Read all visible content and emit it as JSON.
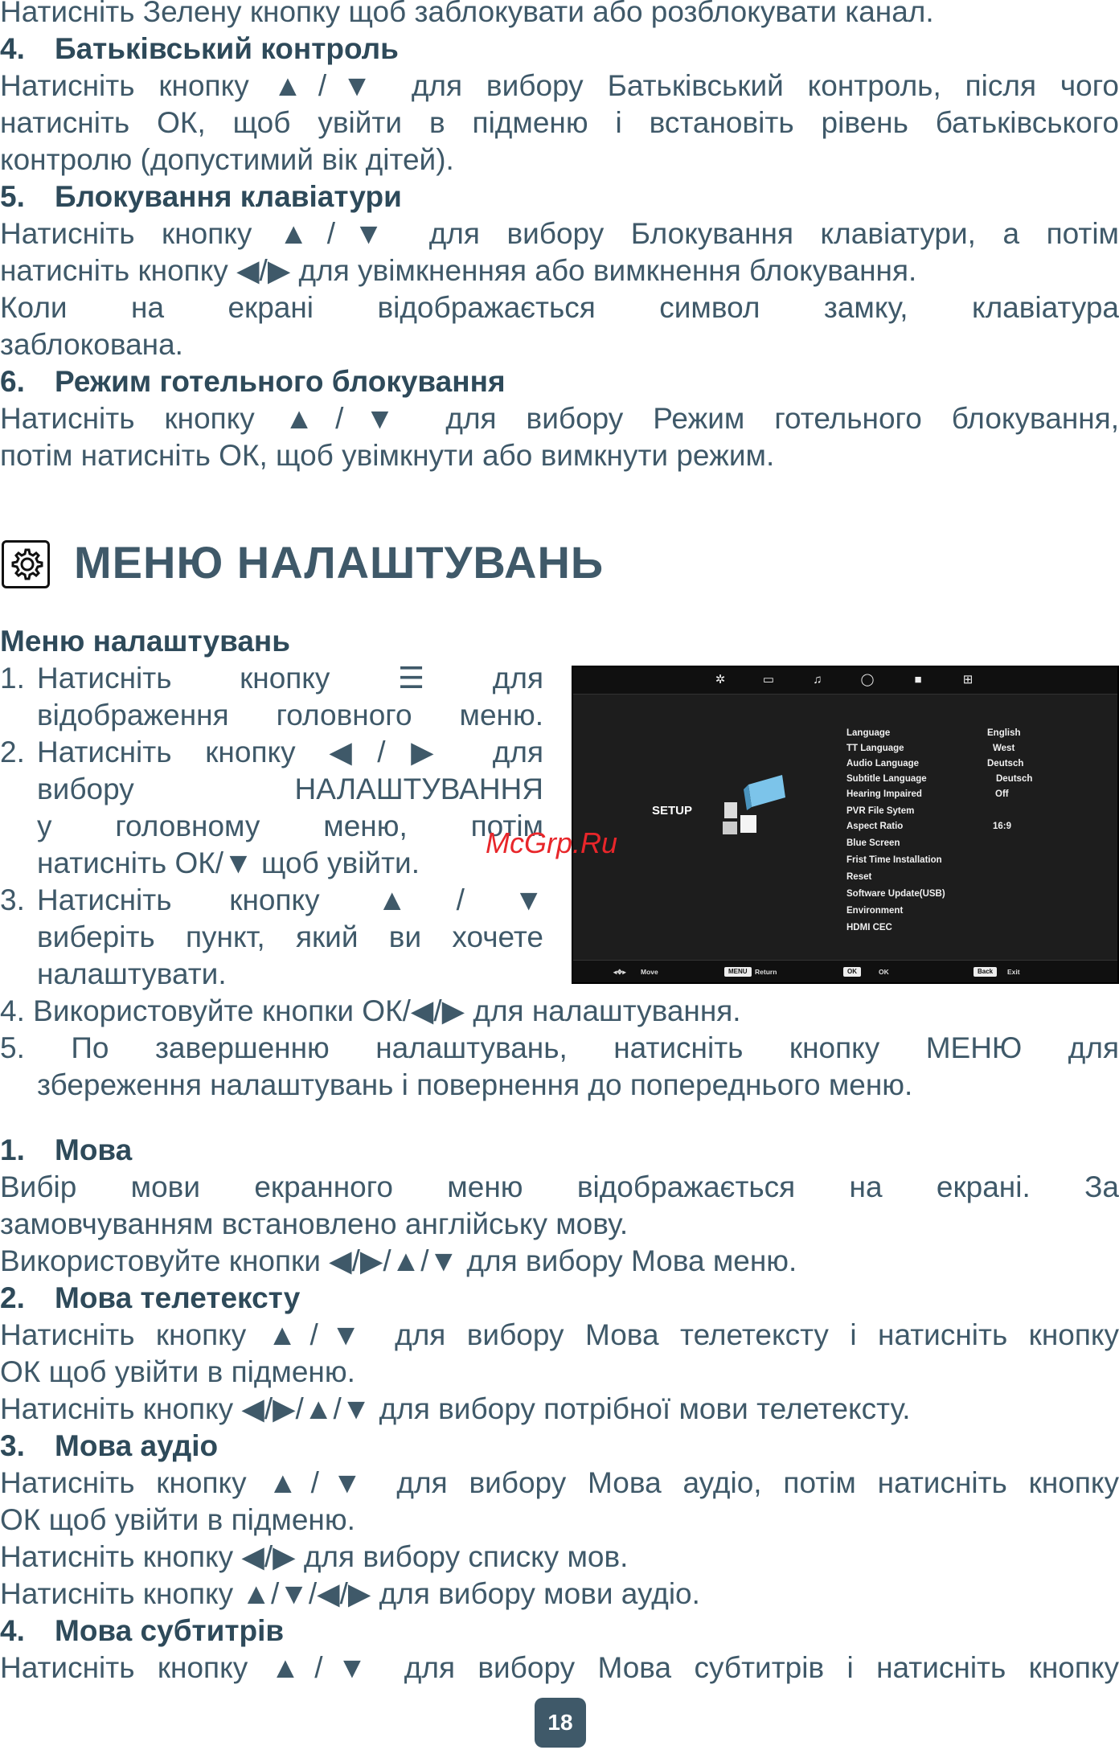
{
  "top_section": {
    "line0": "Натисніть Зелену кнопку щоб заблокувати або розблокувати канал.",
    "h4_num": "4.",
    "h4": "Батьківський контроль",
    "p4_l1": "Натисніть кнопку ▲/▼ для вибору Батьківський контроль, після чого",
    "p4_l2": "натисніть ОК, щоб увійти в підменю і встановіть рівень батьківського",
    "p4_l3": "контролю (допустимий вік дітей).",
    "h5_num": "5.",
    "h5": "Блокування клавіатури",
    "p5_l1": "Натисніть кнопку ▲/▼ для вибору Блокування клавіатури, а потім",
    "p5_l2": "натисніть кнопку ◀/▶ для увімкненняя або вимкнення блокування.",
    "p5_l3": "Коли на екрані відображається символ замку, клавіатура",
    "p5_l4": "заблокована.",
    "h6_num": "6.",
    "h6": "Режим готельного блокування",
    "p6_l1": "Натисніть кнопку ▲/▼ для вибору Режим готельного блокування,",
    "p6_l2": "потім натисніть ОК, щоб увімкнути або вимкнути режим."
  },
  "section": {
    "icon": "gear-icon",
    "title": "МЕНЮ НАЛАШТУВАНЬ",
    "subtitle": "Меню налаштувань"
  },
  "steps": {
    "s1_n": "1.",
    "s1_l1": "Натисніть кнопку ☰ для",
    "s1_l2": "відображення головного меню.",
    "s2_n": "2.",
    "s2_l1": "Натисніть кнопку ◀/▶ для",
    "s2_l2": "вибору НАЛАШТУВАННЯ",
    "s2_l3": "у головному меню, потім",
    "s2_l4": "натисніть ОК/▼ щоб увійти.",
    "s3_n": "3.",
    "s3_l1": "Натисніть кнопку ▲/▼",
    "s3_l2": "виберіть пункт, який ви хочете",
    "s3_l3": "налаштувати.",
    "s4": "4. Використовуйте кнопки ОК/◀/▶ для налаштування.",
    "s5_l1": "5. По завершенню налаштувань, натисніть кнопку МЕНЮ для",
    "s5_l2": "збереження налаштувань і повернення до попереднього меню."
  },
  "tv_screen": {
    "top_icons": [
      "gear-icon",
      "monitor-icon",
      "music-icon",
      "clock-icon",
      "lock-icon",
      "apps-icon"
    ],
    "setup_label": "SETUP",
    "menu": [
      {
        "label": "Language",
        "value": "English"
      },
      {
        "label": "TT Language",
        "value": "West"
      },
      {
        "label": "Audio Language",
        "value": "Deutsch"
      },
      {
        "label": "Subtitle Language",
        "value": "Deutsch"
      },
      {
        "label": "Hearing Impaired",
        "value": "Off"
      },
      {
        "label": "PVR File Sytem",
        "value": ""
      },
      {
        "label": "Aspect Ratio",
        "value": "16:9"
      },
      {
        "label": "Blue Screen",
        "value": ""
      },
      {
        "label": "Frist Time Installation",
        "value": ""
      },
      {
        "label": "Reset",
        "value": ""
      },
      {
        "label": "Software Update(USB)",
        "value": ""
      },
      {
        "label": "Environment",
        "value": ""
      },
      {
        "label": "HDMI CEC",
        "value": ""
      }
    ],
    "bottom": {
      "move_label": "Move",
      "menu_btn": "MENU",
      "return_label": "Return",
      "ok_btn": "OK",
      "ok_label": "OK",
      "back_btn": "Back",
      "exit_label": "Exit"
    }
  },
  "watermark": "McGrp.Ru",
  "lower": {
    "h1_num": "1.",
    "h1": "Мова",
    "p1_l1": "Вибір мови екранного меню відображається на екрані. За",
    "p1_l2": "замовчуванням встановлено англійську мову.",
    "p1_l3": "Використовуйте кнопки ◀/▶/▲/▼ для вибору Мова меню.",
    "h2_num": "2.",
    "h2": "Мова телетексту",
    "p2_l1": "Натисніть кнопку ▲/▼ для вибору Мова телетексту і натисніть кнопку",
    "p2_l2": "ОК щоб увійти в підменю.",
    "p2_l3": "Натисніть кнопку ◀/▶/▲/▼ для вибору потрібної мови телетексту.",
    "h3_num": "3.",
    "h3": "Мова аудіо",
    "p3_l1": "Натисніть кнопку ▲/▼ для вибору Мова аудіо, потім натисніть кнопку",
    "p3_l2": "ОК щоб увійти в підменю.",
    "p3_l3": "Натисніть кнопку ◀/▶ для вибору списку мов.",
    "p3_l4": "Натисніть кнопку ▲/▼/◀/▶ для вибору мови аудіо.",
    "h4_num": "4.",
    "h4": "Мова субтитрів",
    "p4_l1": "Натисніть кнопку ▲/▼ для вибору Мова субтитрів і натисніть кнопку"
  },
  "page_number": "18"
}
